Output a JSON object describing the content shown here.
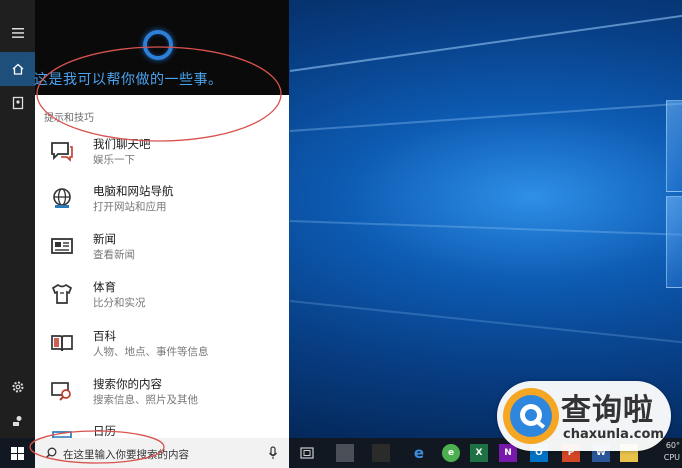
{
  "cortana": {
    "greeting": "这是我可以帮你做的一些事。",
    "section_label": "提示和技巧",
    "items": [
      {
        "title": "我们聊天吧",
        "subtitle": "娱乐一下",
        "icon": "chat-icon"
      },
      {
        "title": "电脑和网站导航",
        "subtitle": "打开网站和应用",
        "icon": "globe-icon"
      },
      {
        "title": "新闻",
        "subtitle": "查看新闻",
        "icon": "news-icon"
      },
      {
        "title": "体育",
        "subtitle": "比分和实况",
        "icon": "jersey-icon"
      },
      {
        "title": "百科",
        "subtitle": "人物、地点、事件等信息",
        "icon": "book-icon"
      },
      {
        "title": "搜索你的内容",
        "subtitle": "搜索信息、照片及其他",
        "icon": "search-content-icon"
      },
      {
        "title": "日历",
        "subtitle": "",
        "icon": "calendar-icon"
      }
    ],
    "accent": "#2d7fd8"
  },
  "taskbar": {
    "search_placeholder": "在这里输入你要搜索的内容",
    "tray": {
      "temp": "60°",
      "cpu": "CPU"
    }
  },
  "watermark": {
    "text_cn": "查询啦",
    "text_en": "chaxunla.com"
  },
  "colors": {
    "rail": "#1f1f1f",
    "header": "#0a0a0a",
    "annotation": "#d9534f"
  }
}
